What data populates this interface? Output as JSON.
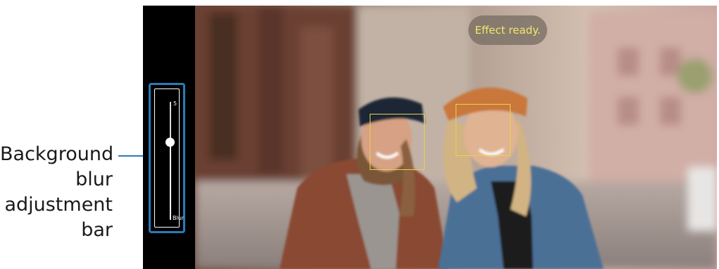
{
  "callout": {
    "lines": [
      "Background",
      "blur",
      "adjustment",
      "bar"
    ],
    "line_color": "#2a7bb8"
  },
  "blur_slider": {
    "value": "5",
    "label": "Blur",
    "level_fraction": 0.34
  },
  "toast": {
    "text": "Effect ready."
  },
  "face_detection": {
    "count": 2,
    "box_color": "#e8d24a"
  },
  "colors": {
    "accent": "#2a7bb8",
    "toast_text": "#f2e76a"
  }
}
